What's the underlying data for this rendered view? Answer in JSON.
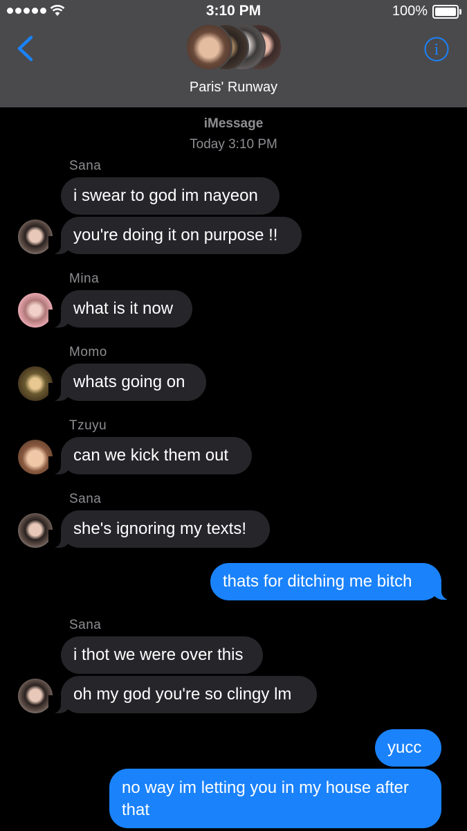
{
  "status": {
    "time": "3:10 PM",
    "battery": "100%"
  },
  "header": {
    "group_name": "Paris' Runway",
    "back_icon": "chevron-left-icon",
    "info_icon": "info-icon",
    "accent": "#1a82fb"
  },
  "thread": {
    "service": "iMessage",
    "timestamp_prefix": "Today",
    "timestamp_time": "3:10 PM"
  },
  "messages": [
    {
      "sender": "Sana",
      "text": "i swear to god im nayeon"
    },
    {
      "text": "you're doing it on purpose !!"
    },
    {
      "sender": "Mina",
      "text": "what is it now"
    },
    {
      "sender": "Momo",
      "text": "whats going on"
    },
    {
      "sender": "Tzuyu",
      "text": "can we kick them out"
    },
    {
      "sender": "Sana",
      "text": "she's ignoring my texts!"
    },
    {
      "text": "thats for ditching me bitch"
    },
    {
      "sender": "Sana",
      "text": "i thot we were over this"
    },
    {
      "text": "oh my god you're so clingy lm"
    },
    {
      "text": "yucc"
    },
    {
      "text": "no way im letting you in my house after that"
    }
  ],
  "colors": {
    "incoming": "#26252a",
    "outgoing": "#1a82fb",
    "header_bg": "#4a4a4c"
  }
}
